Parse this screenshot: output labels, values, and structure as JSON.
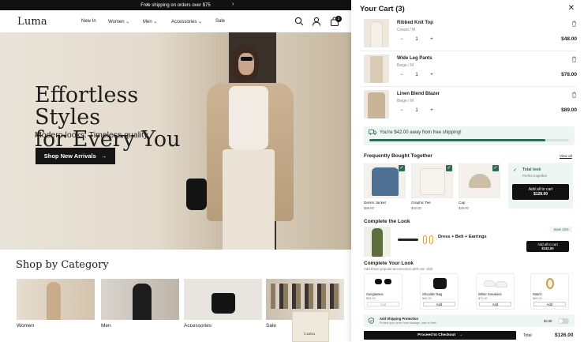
{
  "announcement": {
    "text": "Free shipping on orders over $75",
    "prev": "‹",
    "next": "›"
  },
  "header": {
    "logo": "Luma",
    "nav": [
      {
        "label": "New In"
      },
      {
        "label": "Women"
      },
      {
        "label": "Men"
      },
      {
        "label": "Accessories"
      },
      {
        "label": "Sale"
      }
    ],
    "chevron": "⌄",
    "cart_count": "3"
  },
  "hero": {
    "title_line1": "Effortless Styles",
    "title_line2": "for Every You",
    "subtitle": "Modern looks. Timeless quality.",
    "cta": "Shop New Arrivals",
    "cta_arrow": "→"
  },
  "categories": {
    "title": "Shop by Category",
    "items": [
      {
        "label": "Women"
      },
      {
        "label": "Men"
      },
      {
        "label": "Accessories"
      },
      {
        "label": "Sale"
      }
    ],
    "bag_label": "Luma"
  },
  "cart": {
    "title": "Your Cart (3)",
    "close": "✕",
    "items": [
      {
        "name": "Ribbed Knit Top",
        "variant": "Cream / M",
        "qty": "1",
        "price": "$48.00"
      },
      {
        "name": "Wide Leg Pants",
        "variant": "Beige / M",
        "qty": "1",
        "price": "$78.00"
      },
      {
        "name": "Linen Blend Blazer",
        "variant": "Beige / M",
        "qty": "1",
        "price": "$89.00"
      }
    ],
    "minus": "−",
    "plus": "+",
    "shipping": {
      "text": "You're $42.00 away from free shipping!",
      "progress": 0.88
    },
    "fbt": {
      "title": "Frequently Bought Together",
      "view_all": "View all",
      "products": [
        {
          "name": "Denim Jacket",
          "price": "$68.00"
        },
        {
          "name": "Graphic Tee",
          "price": "$32.00"
        },
        {
          "name": "Cap",
          "price": "$28.00"
        }
      ],
      "total_label": "Total look",
      "total_sub": "Perfect together",
      "add_btn": "Add all to cart",
      "add_price": "$128.00"
    },
    "complete_look": {
      "title": "Complete the Look",
      "save": "Save 15%",
      "desc": "Dress + Belt + Earrings",
      "add_btn": "Add all to cart",
      "add_price": "$142.00"
    },
    "accessories": {
      "title": "Complete Your Look",
      "subtitle": "Add these popular accessories with one click",
      "items": [
        {
          "name": "Sunglasses",
          "price": "$35.00",
          "btn": "Add"
        },
        {
          "name": "Shoulder Bag",
          "price": "$65.00",
          "btn": "Add"
        },
        {
          "name": "White Sneakers",
          "price": "$72.00",
          "btn": "Add"
        },
        {
          "name": "Watch",
          "price": "$89.00",
          "btn": "Add"
        }
      ]
    },
    "protection": {
      "title": "Add Shipping Protection",
      "subtitle": "Protect your order from damage, loss or theft.",
      "price": "$4.98"
    },
    "checkout": {
      "label": "Proceed to Checkout",
      "arrow": "→"
    },
    "total": {
      "label": "Total",
      "value": "$126.00"
    }
  },
  "colors": {
    "accent": "#2e6b57",
    "dark": "#111111",
    "ship_bg": "#eef6f3"
  }
}
